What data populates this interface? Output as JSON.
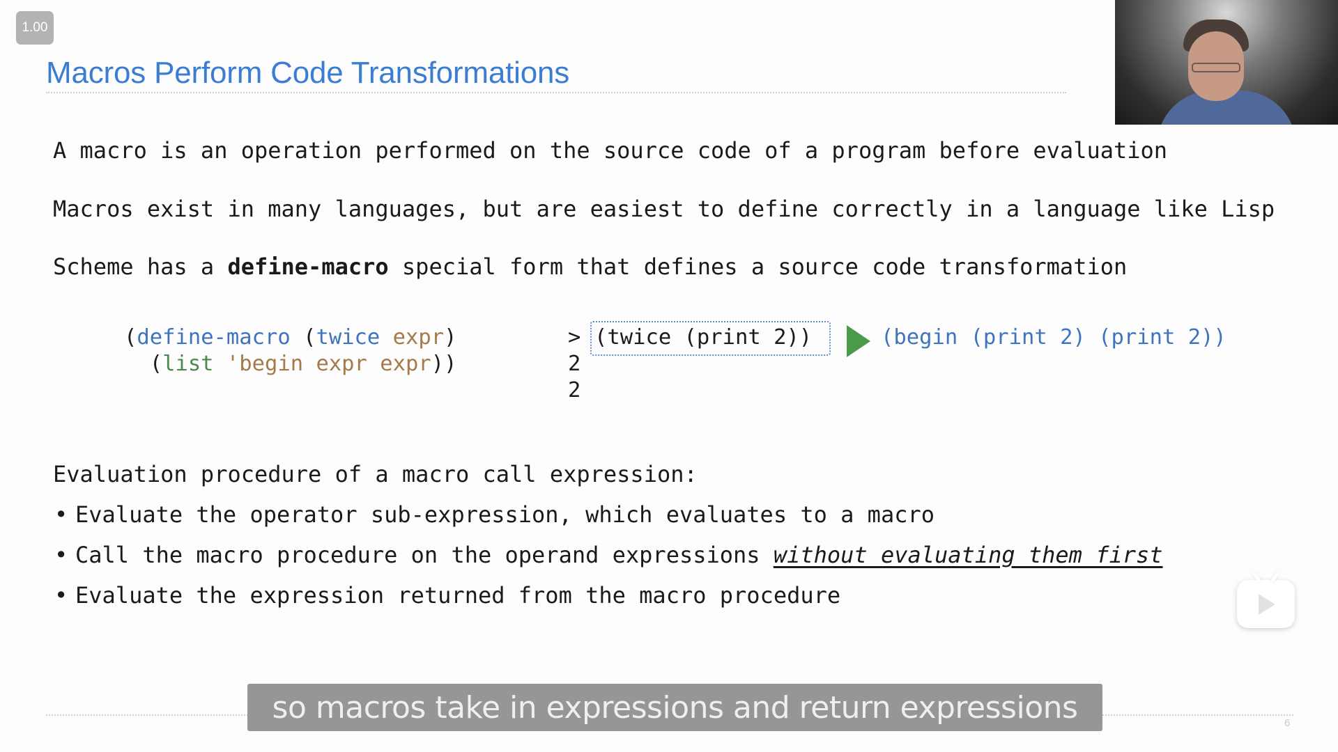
{
  "player": {
    "speed_label": "1.00",
    "subtitle": "so macros take in expressions and return expressions",
    "tv_icon": "tv-play-icon"
  },
  "slide": {
    "title": "Macros Perform Code Transformations",
    "page_number": "6",
    "paragraphs": {
      "p1": "A macro is an operation performed on the source code of a program before evaluation",
      "p2": "Macros exist in many languages, but are easiest to define correctly in a language like Lisp",
      "p3_before": "Scheme has a ",
      "p3_bold": "define-macro",
      "p3_after": " special form that defines a source code transformation"
    },
    "code": {
      "line1": {
        "open": "(",
        "keyword": "define-macro",
        "space_paren": " (",
        "name": "twice",
        "space": " ",
        "param": "expr",
        "close": ")"
      },
      "line2": {
        "indent_open": "  (",
        "func": "list",
        "space": " ",
        "quoted": "'begin expr expr",
        "close": "))"
      }
    },
    "repl": {
      "prompt": ">",
      "input": "(twice (print 2))",
      "outputs": [
        "2",
        "2"
      ],
      "expansion": "(begin (print 2) (print 2))",
      "arrow_icon": "play-arrow-icon"
    },
    "evaluation": {
      "heading": "Evaluation procedure of a macro call expression:",
      "bullet_glyph": "•",
      "bullets": [
        {
          "text": "Evaluate the operator sub-expression, which evaluates to a macro"
        },
        {
          "text": "Call the macro procedure on the operand expressions ",
          "emphasis": "without evaluating them first"
        },
        {
          "text": "Evaluate the expression returned from the macro procedure"
        }
      ]
    }
  },
  "colors": {
    "title": "#3b7dd3",
    "code_blue": "#3e74bd",
    "code_green": "#4a8a4a",
    "code_brown": "#a57a4a",
    "arrow_green": "#4a9a4a",
    "subtitle_bg": "#969696"
  }
}
